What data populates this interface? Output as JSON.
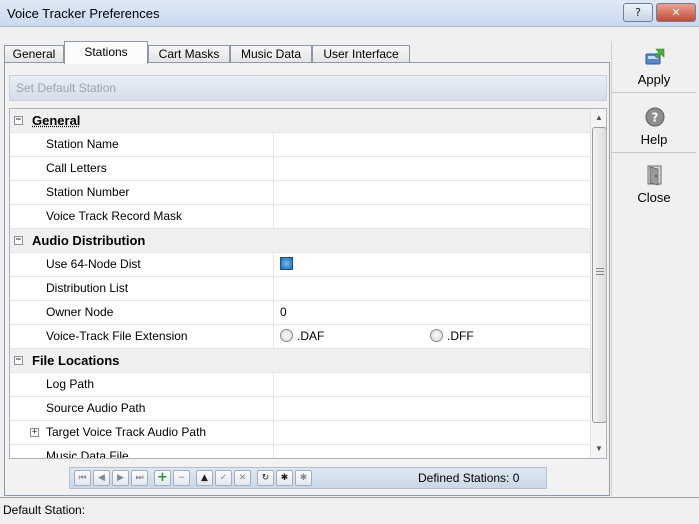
{
  "window": {
    "title": "Voice Tracker Preferences",
    "help_glyph": "?",
    "close_glyph": "✕"
  },
  "tabs": [
    {
      "label": "General"
    },
    {
      "label": "Stations"
    },
    {
      "label": "Cart Masks"
    },
    {
      "label": "Music Data"
    },
    {
      "label": "User Interface"
    }
  ],
  "active_tab": "Stations",
  "set_default_label": "Set Default Station",
  "grid": {
    "categories": {
      "general": "General",
      "audio": "Audio Distribution",
      "files": "File Locations"
    },
    "props": {
      "station_name": "Station Name",
      "call_letters": "Call Letters",
      "station_number": "Station Number",
      "record_mask": "Voice Track Record Mask",
      "use64": "Use 64-Node Dist",
      "dist_list": "Distribution List",
      "owner_node": "Owner Node",
      "owner_node_value": "0",
      "file_ext": "Voice-Track File Extension",
      "opt_daf": ".DAF",
      "opt_dff": ".DFF",
      "log_path": "Log Path",
      "source_audio": "Source Audio Path",
      "target_audio": "Target Voice Track Audio Path",
      "music_file": "Music Data File"
    },
    "use64_checked": true
  },
  "nav": {
    "first": "⏮",
    "prev": "◀",
    "next": "▶",
    "last": "⏭",
    "add": "+",
    "remove": "−",
    "up": "▲",
    "accept": "✓",
    "cancel": "✕",
    "refresh": "↻",
    "star": "✱",
    "star2": "✱",
    "info": "Defined Stations: 0"
  },
  "toolbar": {
    "apply": "Apply",
    "help": "Help",
    "close": "Close"
  },
  "status": "Default Station:"
}
